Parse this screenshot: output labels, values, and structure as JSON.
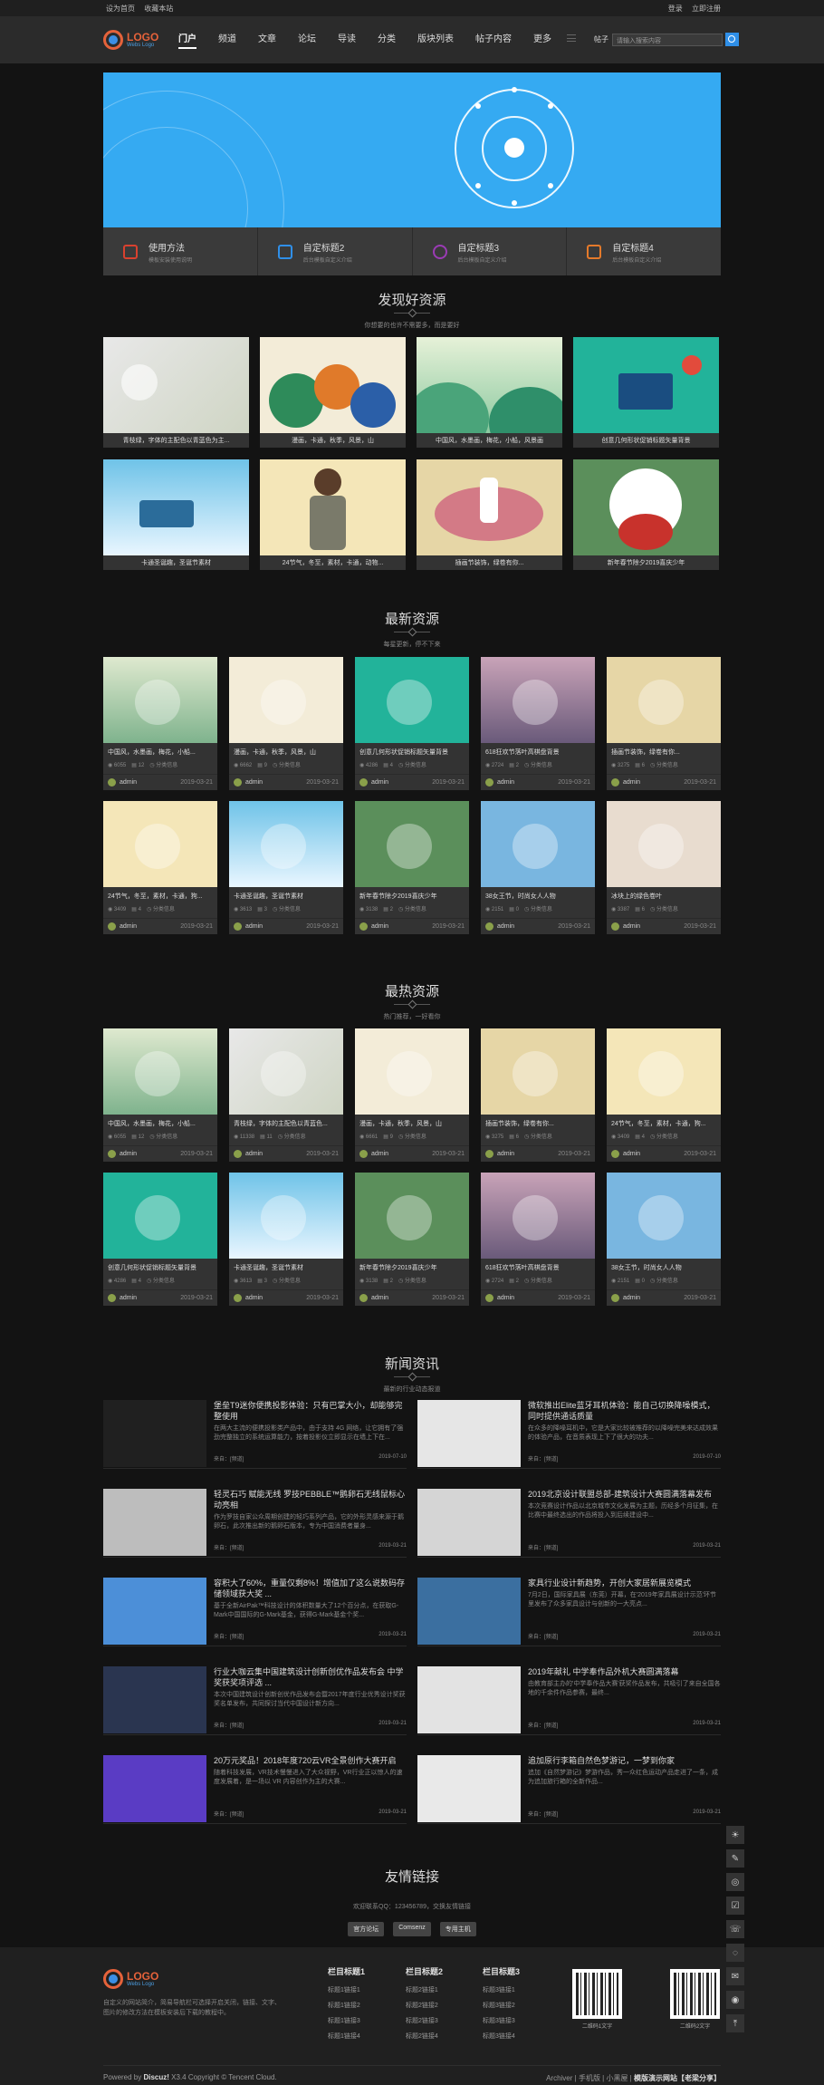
{
  "topbar": {
    "set_home": "设为首页",
    "favorite": "收藏本站",
    "login": "登录",
    "register": "立即注册"
  },
  "logo": {
    "text": "LOGO",
    "sub": "Webs Logo"
  },
  "nav": [
    "门户",
    "频道",
    "文章",
    "论坛",
    "导读",
    "分类",
    "版块列表",
    "帖子内容",
    "更多"
  ],
  "search": {
    "type": "帖子",
    "placeholder": "请输入搜索内容"
  },
  "features": [
    {
      "title": "使用方法",
      "desc": "模板安装使用说明",
      "color": "#d9412f"
    },
    {
      "title": "自定标题2",
      "desc": "后台模板自定义介绍",
      "color": "#2f8fe8"
    },
    {
      "title": "自定标题3",
      "desc": "后台模板自定义介绍",
      "color": "#9b3bb5"
    },
    {
      "title": "自定标题4",
      "desc": "后台模板自定义介绍",
      "color": "#e57a2a"
    }
  ],
  "discover": {
    "title": "发现好资源",
    "sub": "你想要的也许不需要多，而是要好",
    "items": [
      "青枝绿，字体的主配色以青蓝色为主...",
      "漫画，卡通，秋季，风景，山",
      "中国风，水墨画，梅花，小船，风景画",
      "创意几何形状促销标题矢量背景",
      "卡通圣诞趣，圣诞节素材",
      "24节气，冬至，素材，卡通，动物...",
      "插画节装饰，绿卷有你...",
      "新年春节除夕2019喜庆少年"
    ]
  },
  "latest": {
    "title": "最新资源",
    "sub": "每星更新，停不下来",
    "items": [
      {
        "cap": "中国风，水墨画，梅花，小船...",
        "views": "6055",
        "comments": "12",
        "status": "分类信息",
        "author": "admin",
        "date": "2019-03-21"
      },
      {
        "cap": "漫画，卡通，秋季，风景，山",
        "views": "6662",
        "comments": "9",
        "status": "分类信息",
        "author": "admin",
        "date": "2019-03-21"
      },
      {
        "cap": "创意几何形状促销标题矢量背景",
        "views": "4286",
        "comments": "4",
        "status": "分类信息",
        "author": "admin",
        "date": "2019-03-21"
      },
      {
        "cap": "618狂欢节落叶高棋盘背景",
        "views": "2724",
        "comments": "2",
        "status": "分类信息",
        "author": "admin",
        "date": "2019-03-21"
      },
      {
        "cap": "插画节装饰，绿卷有你...",
        "views": "3275",
        "comments": "6",
        "status": "分类信息",
        "author": "admin",
        "date": "2019-03-21"
      },
      {
        "cap": "24节气，冬至，素材，卡通，狗...",
        "views": "3409",
        "comments": "4",
        "status": "分类信息",
        "author": "admin",
        "date": "2019-03-21"
      },
      {
        "cap": "卡通圣诞趣，圣诞节素材",
        "views": "3613",
        "comments": "3",
        "status": "分类信息",
        "author": "admin",
        "date": "2019-03-21"
      },
      {
        "cap": "新年春节除夕2019喜庆少年",
        "views": "3138",
        "comments": "2",
        "status": "分类信息",
        "author": "admin",
        "date": "2019-03-21"
      },
      {
        "cap": "38女王节，时尚女人人物",
        "views": "2151",
        "comments": "0",
        "status": "分类信息",
        "author": "admin",
        "date": "2019-03-21"
      },
      {
        "cap": "冰块上的绿色卷叶",
        "views": "3387",
        "comments": "6",
        "status": "分类信息",
        "author": "admin",
        "date": "2019-03-21"
      }
    ]
  },
  "hot": {
    "title": "最热资源",
    "sub": "热门推荐，一好看你",
    "items": [
      {
        "cap": "中国风，水墨画，梅花，小船...",
        "views": "6055",
        "comments": "12",
        "status": "分类信息",
        "author": "admin",
        "date": "2019-03-21"
      },
      {
        "cap": "青枝绿，字体的主配色以青蓝色...",
        "views": "11338",
        "comments": "11",
        "status": "分类信息",
        "author": "admin",
        "date": "2019-03-21"
      },
      {
        "cap": "漫画，卡通，秋季，风景，山",
        "views": "6661",
        "comments": "9",
        "status": "分类信息",
        "author": "admin",
        "date": "2019-03-21"
      },
      {
        "cap": "插画节装饰，绿卷有你...",
        "views": "3275",
        "comments": "6",
        "status": "分类信息",
        "author": "admin",
        "date": "2019-03-21"
      },
      {
        "cap": "24节气，冬至，素材，卡通，狗...",
        "views": "3409",
        "comments": "4",
        "status": "分类信息",
        "author": "admin",
        "date": "2019-03-21"
      },
      {
        "cap": "创意几何形状促销标题矢量背景",
        "views": "4286",
        "comments": "4",
        "status": "分类信息",
        "author": "admin",
        "date": "2019-03-21"
      },
      {
        "cap": "卡通圣诞趣，圣诞节素材",
        "views": "3613",
        "comments": "3",
        "status": "分类信息",
        "author": "admin",
        "date": "2019-03-21"
      },
      {
        "cap": "新年春节除夕2019喜庆少年",
        "views": "3138",
        "comments": "2",
        "status": "分类信息",
        "author": "admin",
        "date": "2019-03-21"
      },
      {
        "cap": "618狂欢节落叶高棋盘背景",
        "views": "2724",
        "comments": "2",
        "status": "分类信息",
        "author": "admin",
        "date": "2019-03-21"
      },
      {
        "cap": "38女王节，时尚女人人物",
        "views": "2151",
        "comments": "0",
        "status": "分类信息",
        "author": "admin",
        "date": "2019-03-21"
      }
    ]
  },
  "newsSection": {
    "title": "新闻资讯",
    "sub": "最新的行业动态报道",
    "items": [
      {
        "title": "堡垒T9迷你便携投影体验：只有巴掌大小，却能够完整使用",
        "desc": "在两大主流的便携投影类产品中，由于支持 4G 网络，让它拥有了强劲完整独立的系统运算能力，按着投影仪立即显示在墙上下在...",
        "date": "2019-07-10",
        "src": "来自：[频道]"
      },
      {
        "title": "微软推出Elite蓝牙耳机体验：能自己切换降噪模式，同时提供通话质量",
        "desc": "在众多的降噪耳机中，它是大家比较被推荐的以降噪完美来达成效果的体验产品，在音质表现上下了很大的功夫...",
        "date": "2019-07-10",
        "src": "来自：[频道]"
      },
      {
        "title": "轻灵石巧 赋能无线 罗技PEBBLE™鹅卵石无线鼠标心动亮相",
        "desc": "作为罗技自家公众周期创建的轻巧系列产品，它的外形灵感来源于鹅卵石，此次推出新的鹅卵石版本，专为中国消费者量身...",
        "date": "2019-03-21",
        "src": "来自：[频道]"
      },
      {
        "title": "2019北京设计联盟总部-建筑设计大赛圆满落幕发布",
        "desc": "本次竞赛设计作品以北京城市文化发展为主题，历经多个月征集，在比赛中最终选出的作品将投入到后续建设中...",
        "date": "2019-03-21",
        "src": "来自：[频道]"
      },
      {
        "title": "容积大了60%，重量仅剩8%！增值加了这么说数码存储领域获大奖 ...",
        "desc": "基于全新AirPak™科技设计的体积数量大了12个百分点，在获取G-Mark中国国际的G-Mark基金，获得G-Mark基金个奖...",
        "date": "2019-03-21",
        "src": "来自：[频道]"
      },
      {
        "title": "家具行业设计新趋势，开创大家居新展览模式",
        "desc": "7月2日，国际家具展（东莞）开幕，在'2019年家具展设计示范'环节里发布了众多家具设计与创新的一大亮点...",
        "date": "2019-03-21",
        "src": "来自：[频道]"
      },
      {
        "title": "行业大咖云集中国建筑设计创新创优作品发布会 中学奖获奖项评选 ...",
        "desc": "本次中国建筑设计创新创优作品发布会暨2017年度行业优秀设计奖获奖名单发布，共同探讨当代中国设计新方向...",
        "date": "2019-03-21",
        "src": "来自：[频道]"
      },
      {
        "title": "2019年献礼 中学奉作品外机大赛圆满落幕",
        "desc": "由教育部主办的'中学奉作品大赛'获奖作品发布，共吸引了来自全国各地的千余件作品参赛，最终...",
        "date": "2019-03-21",
        "src": "来自：[频道]"
      },
      {
        "title": "20万元奖品！2018年度720云VR全景创作大赛开启",
        "desc": "随着科技发展，VR技术慢慢进入了大众视野，VR行业正以惊人的速度发展着，是一场以 VR 内容创作为主的大赛...",
        "date": "2019-03-21",
        "src": "来自：[频道]"
      },
      {
        "title": "追加原行李箱自然色梦游记，一梦到你家",
        "desc": "追加《自然梦游记》梦游作品，秀一众红色运动产品走进了一条，成为追加旅行箱的全新作品...",
        "date": "2019-03-21",
        "src": "来自：[频道]"
      }
    ]
  },
  "links": {
    "title": "友情链接",
    "contact": "欢迎联系QQ：123456789，交换友情链接",
    "items": [
      "官方论坛",
      "Comsenz",
      "专用主机"
    ]
  },
  "footer": {
    "logo": "LOGO",
    "desc": "自定义的网站简介，简易导航栏可选择开启关闭，链接、文字、图片的修改方法在模板安装后下载的教程中。",
    "cols": [
      {
        "title": "栏目标题1",
        "items": [
          "标题1链接1",
          "标题1链接2",
          "标题1链接3",
          "标题1链接4"
        ]
      },
      {
        "title": "栏目标题2",
        "items": [
          "标题2链接1",
          "标题2链接2",
          "标题2链接3",
          "标题2链接4"
        ]
      },
      {
        "title": "栏目标题3",
        "items": [
          "标题3链接1",
          "标题3链接2",
          "标题3链接3",
          "标题3链接4"
        ]
      }
    ],
    "qr1": "二维码1文字",
    "qr2": "二维码2文字",
    "powered_prefix": "Powered by",
    "brand": "Discuz!",
    "version": "X3.4",
    "copyright": "Copyright © Tencent Cloud.",
    "bottom_links": "Archiver | 手机版 | 小黑屋 |",
    "site_name": "模版演示网站【老梁分享】"
  }
}
